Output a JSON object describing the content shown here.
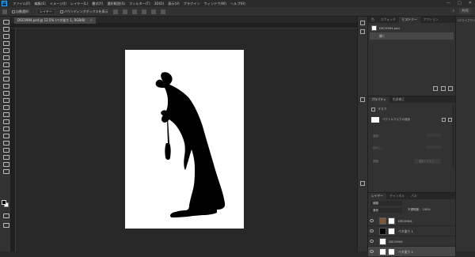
{
  "app": {
    "logo": "Ps"
  },
  "menu": [
    "ファイル(F)",
    "編集(E)",
    "イメージ(I)",
    "レイヤー(L)",
    "書式(Y)",
    "選択範囲(S)",
    "フィルター(T)",
    "3D(D)",
    "表示(V)",
    "プラグイン",
    "ウィンドウ(W)",
    "ヘルプ(H)"
  ],
  "window_controls": {
    "minimize": "—",
    "maximize": "□",
    "close": "✕"
  },
  "options": {
    "auto_select": "自動選択：",
    "target": "レイヤー",
    "transform": "バウンディングボックスを表示"
  },
  "options_right": {
    "share": "共有"
  },
  "doc_tab": {
    "title": "DSC0904.psd @ 12.5% (ベタ塗り 1, RGB/8)",
    "close": "✕"
  },
  "history_panel": {
    "tabs": [
      "色",
      "スウォッチ",
      "ヒストリー",
      "アクション"
    ],
    "items": [
      {
        "label": "DSC0904.psd"
      },
      {
        "label": "開く"
      }
    ]
  },
  "properties_panel": {
    "tabs": [
      "プロパティ",
      "色調補正"
    ],
    "kind": "マスク",
    "mask_label": "ベクトルマスクの追加",
    "density": "濃度：",
    "feather": "ぼかし：",
    "refine": "調整：",
    "select_btn": "選択とマスク..."
  },
  "layers_panel": {
    "tabs": [
      "レイヤー",
      "チャンネル",
      "パス"
    ],
    "filter": "種類",
    "blend": "通常",
    "opacity_label": "不透明度：",
    "opacity": "100%",
    "layers": [
      {
        "name": "DSC0904"
      },
      {
        "name": "ベタ塗り 1"
      },
      {
        "name": "DSC0904"
      },
      {
        "name": "ベタ塗り 2"
      }
    ]
  },
  "right_panel": {
    "label": "CCライブラリ"
  },
  "icons": {
    "eye": "eye-icon",
    "lock": "lock-icon"
  },
  "colors": {
    "bg": "#282828",
    "panel": "#323232",
    "selected": "#474747",
    "accent": "#31a8ff"
  }
}
